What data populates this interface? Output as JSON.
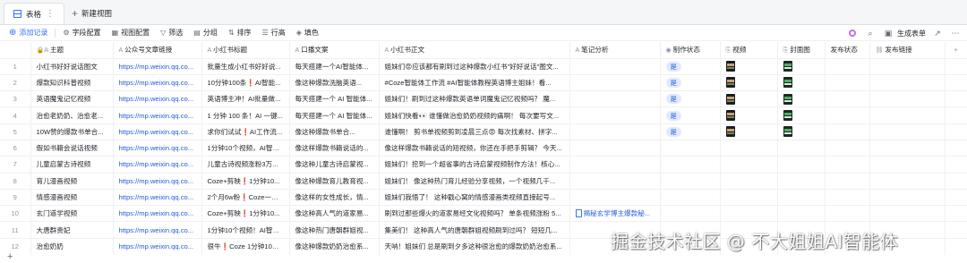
{
  "tabs": {
    "table_label": "表格",
    "new_view": "新建视图"
  },
  "toolbar": {
    "add_record": "添加记录",
    "field_config": "字段配置",
    "view_config": "视图配置",
    "filter": "筛选",
    "group": "分组",
    "sort": "排序",
    "row_height": "行高",
    "fill": "填色",
    "generate_form": "生成表单"
  },
  "columns": [
    "主题",
    "公众号文章链接",
    "小红书标题",
    "口播文案",
    "小红书正文",
    "笔记分析",
    "制作状态",
    "视频",
    "封面图",
    "发布状态",
    "发布链接"
  ],
  "rows": [
    {
      "n": "1",
      "topic": "小红书好好说话图文",
      "url": "https://mp.weixin.qq.co...",
      "title": "批量生成小红书好好说...",
      "script": "每天搭建一个AI智能体...",
      "body": "姐妹们😡应该都有刷到过这种爆款小红书\"好好说话\"图文...",
      "analysis": "",
      "status": "是"
    },
    {
      "n": "2",
      "topic": "爆款知识科普视频",
      "url": "https://mp.weixin.qq.co...",
      "title": "10分钟100条❗AI智能...",
      "script": "像这种爆款洗脑英语...",
      "body": "#Coze智能体工作流 #AI智能体教程英语博主姐妹！看...",
      "analysis": "",
      "status": "是"
    },
    {
      "n": "3",
      "topic": "英语魔鬼记忆视频",
      "url": "https://mp.weixin.qq.co...",
      "title": "英语博主冲！AI批量做...",
      "script": "每天搭建一个 AI 智能体...",
      "body": "姐妹们！刷到过这种爆款英语单词魔鬼记忆视频吗？ 魔...",
      "analysis": "",
      "status": "是"
    },
    {
      "n": "4",
      "topic": "治愈老奶奶、治愈老...",
      "url": "https://mp.weixin.qq.co...",
      "title": "1 分钟 100 条！AI 一键...",
      "script": "每天搭建一个 AI 智能体...",
      "body": "姐妹们快看👀 谁懂做治愈奶奶视频的痛啊！ 每次要写文...",
      "analysis": "",
      "status": "是"
    },
    {
      "n": "5",
      "topic": "10W赞的爆款书单合...",
      "url": "https://mp.weixin.qq.co...",
      "title": "求你们试试❗AI工作流...",
      "script": "像这种爆款书单合...",
      "body": "谁懂啊！ 剪书单视频剪到凌晨三点😡 每次找素材、拼字...",
      "analysis": "",
      "status": "是"
    },
    {
      "n": "6",
      "topic": "假如书籍会说话视频",
      "url": "https://mp.weixin.qq.co...",
      "title": "1分钟10个视频，AI智能...",
      "script": "像这样爆款书籍说话的...",
      "body": "像这样爆款书籍说话的短视频，你还在手把手剪辑？ 今天...",
      "analysis": "",
      "status": ""
    },
    {
      "n": "7",
      "topic": "儿童启蒙古诗视频",
      "url": "https://mp.weixin.qq.co...",
      "title": "儿童古诗视频涨粉3万...",
      "script": "像这种儿童古诗启蒙视...",
      "body": "姐妹们！挖到一个超省事的古诗启蒙视频制作方法！核心...",
      "analysis": "",
      "status": ""
    },
    {
      "n": "8",
      "topic": "育儿漫画视频",
      "url": "https://mp.weixin.qq.co...",
      "title": "Coze+剪映❗1分钟10...",
      "script": "像这种爆款育儿教育视...",
      "body": "姐妹们！ 像这种热门育儿经验分享视频，一个视频几千...",
      "analysis": "",
      "status": ""
    },
    {
      "n": "9",
      "topic": "情感漫画视频",
      "url": "https://mp.weixin.qq.co...",
      "title": "2个月6w粉❗Coze一分...",
      "script": "像这样的女性成长，情...",
      "body": "姐妹们我悟了！ 这种戳心窝的情感漫画类视频直接起号...",
      "analysis": "",
      "status": ""
    },
    {
      "n": "10",
      "topic": "玄门道学视频",
      "url": "https://mp.weixin.qq.co...",
      "title": "Coze+剪映❗1分钟10...",
      "script": "像这种高人气的道家易...",
      "body": "刷到过那些爆火的道家易经文化视频吗？ 单条视频涨粉 5...",
      "analysis": "揭秘玄学博主爆款秘...",
      "status": ""
    },
    {
      "n": "11",
      "topic": "大唐群贵妃",
      "url": "https://mp.weixin.qq.co...",
      "title": "1分钟10个视频！AI智能...",
      "script": "像这种热门唐朝群姐视...",
      "body": "集美们！ 这种高人气的唐朝群姐视频刷到过吗？ 短短几...",
      "analysis": "",
      "status": ""
    },
    {
      "n": "12",
      "topic": "治愈奶奶",
      "url": "https://mp.weixin.qq.co...",
      "title": "很牛❗Coze 1分钟10个...",
      "script": "像这种爆款奶奶治愈系...",
      "body": "天呐！姐妹们 总是刷到夕多这种很治愈的爆款奶奶治愈系...",
      "analysis": "",
      "status": ""
    }
  ],
  "watermark": "掘金技术社区 @ 不大姐姐AI智能体"
}
